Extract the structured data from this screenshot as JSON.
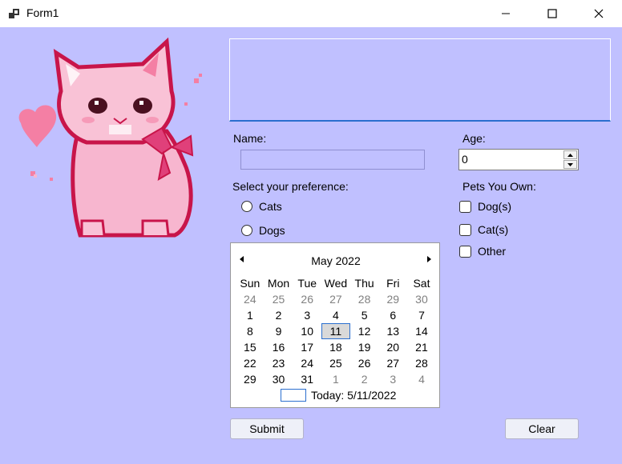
{
  "window": {
    "title": "Form1"
  },
  "form": {
    "name_label": "Name:",
    "name_value": "",
    "age_label": "Age:",
    "age_value": "0",
    "preference_label": "Select your preference:",
    "preference_options": [
      "Cats",
      "Dogs"
    ],
    "pets_label": "Pets You Own:",
    "pets_options": [
      "Dog(s)",
      "Cat(s)",
      "Other"
    ],
    "submit_label": "Submit",
    "clear_label": "Clear"
  },
  "calendar": {
    "month_label": "May 2022",
    "weekdays": [
      "Sun",
      "Mon",
      "Tue",
      "Wed",
      "Thu",
      "Fri",
      "Sat"
    ],
    "weeks": [
      [
        "24",
        "25",
        "26",
        "27",
        "28",
        "29",
        "30"
      ],
      [
        "1",
        "2",
        "3",
        "4",
        "5",
        "6",
        "7"
      ],
      [
        "8",
        "9",
        "10",
        "11",
        "12",
        "13",
        "14"
      ],
      [
        "15",
        "16",
        "17",
        "18",
        "19",
        "20",
        "21"
      ],
      [
        "22",
        "23",
        "24",
        "25",
        "26",
        "27",
        "28"
      ],
      [
        "29",
        "30",
        "31",
        "1",
        "2",
        "3",
        "4"
      ]
    ],
    "selected_day": "11",
    "today_label": "Today: 5/11/2022"
  },
  "colors": {
    "client_background": "#c0c0ff",
    "accent": "#2b6fcf",
    "kitten_pink": "#f7b6cf",
    "kitten_outline": "#c8154a"
  },
  "icons": {
    "app": "app-form-icon",
    "minimize": "minimize-icon",
    "maximize": "maximize-icon",
    "close": "close-icon",
    "prev": "triangle-left-icon",
    "next": "triangle-right-icon",
    "spin_up": "arrow-up-icon",
    "spin_down": "arrow-down-icon"
  }
}
